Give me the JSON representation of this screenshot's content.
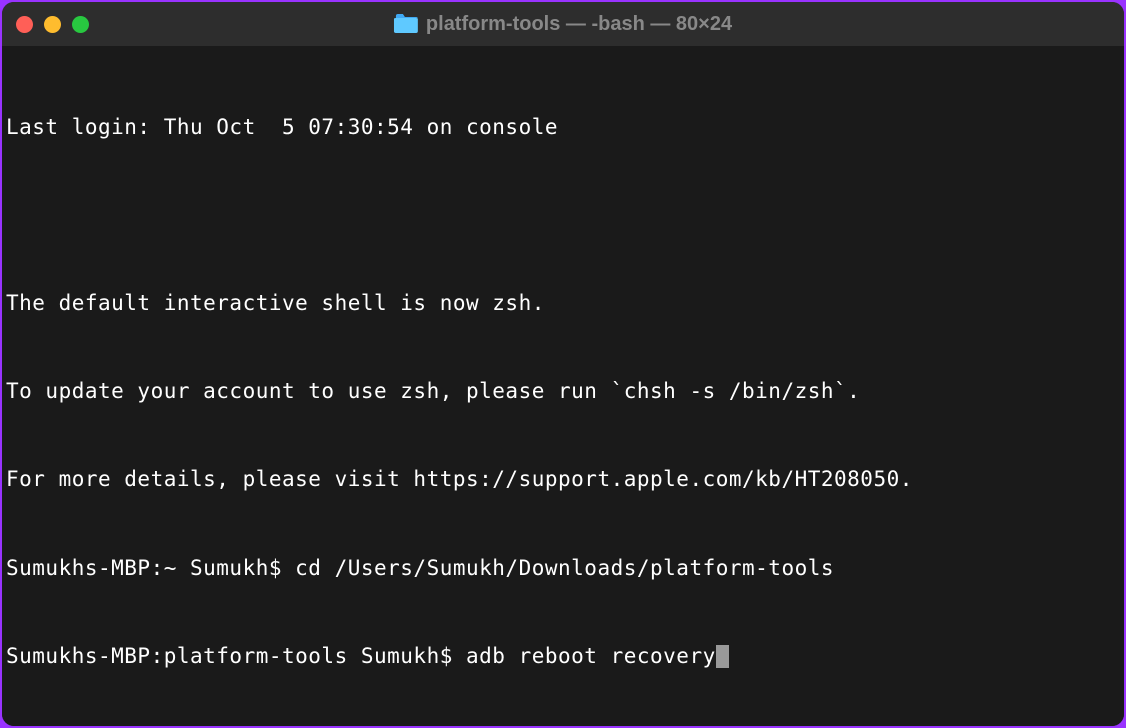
{
  "window": {
    "title": "platform-tools — -bash — 80×24"
  },
  "terminal": {
    "lines": [
      "Last login: Thu Oct  5 07:30:54 on console",
      "",
      "The default interactive shell is now zsh.",
      "To update your account to use zsh, please run `chsh -s /bin/zsh`.",
      "For more details, please visit https://support.apple.com/kb/HT208050.",
      "Sumukhs-MBP:~ Sumukh$ cd /Users/Sumukh/Downloads/platform-tools",
      "Sumukhs-MBP:platform-tools Sumukh$ adb reboot recovery"
    ]
  }
}
